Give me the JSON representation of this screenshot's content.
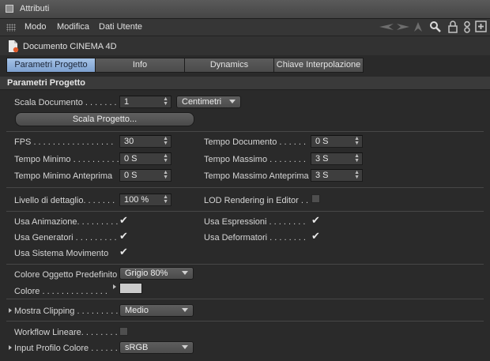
{
  "window": {
    "title": "Attributi"
  },
  "menu": {
    "items": [
      "Modo",
      "Modifica",
      "Dati Utente"
    ]
  },
  "toolbar_icons": [
    "back-arrow-icon",
    "forward-arrow-icon",
    "up-arrow-icon",
    "search-icon",
    "lock-icon",
    "link-icon",
    "new-panel-icon"
  ],
  "document": {
    "title": "Documento CINEMA 4D"
  },
  "tabs": [
    "Parametri Progetto",
    "Info",
    "Dynamics",
    "Chiave Interpolazione"
  ],
  "active_tab": "Parametri Progetto",
  "section": {
    "title": "Parametri Progetto"
  },
  "scala": {
    "label": "Scala Documento . . . . . . .",
    "value": "1",
    "unit": "Centimetri",
    "button": "Scala Progetto..."
  },
  "time": {
    "fps": {
      "label": "FPS . . . . . . . . . . . . . . . . .",
      "value": "30"
    },
    "tempo_minimo": {
      "label": "Tempo Minimo . . . . . . . . . .",
      "value": "0 S"
    },
    "tempo_minimo_anteprima": {
      "label": "Tempo Minimo Anteprima",
      "value": "0 S"
    },
    "tempo_documento": {
      "label": "Tempo Documento . . . . . .",
      "value": "0 S"
    },
    "tempo_massimo": {
      "label": "Tempo Massimo . . . . . . . .",
      "value": "3 S"
    },
    "tempo_massimo_anteprima": {
      "label": "Tempo Massimo Anteprima",
      "value": "3 S"
    }
  },
  "lod": {
    "label": "Livello di dettaglio. . . . . . .",
    "value": "100 %",
    "render_label": "LOD Rendering in Editor . .",
    "render_checked": false
  },
  "flags": {
    "usa_animazione": {
      "label": "Usa Animazione. . . . . . . . .",
      "checked": true
    },
    "usa_generatori": {
      "label": "Usa Generatori . . . . . . . . .",
      "checked": true
    },
    "usa_sistema_movimento": {
      "label": "Usa Sistema Movimento",
      "checked": true
    },
    "usa_espressioni": {
      "label": "Usa Espressioni . . . . . . . .",
      "checked": true
    },
    "usa_deformatori": {
      "label": "Usa Deformatori . . . . . . . .",
      "checked": true
    }
  },
  "colore": {
    "oggetto_label": "Colore Oggetto Predefinito",
    "oggetto_value": "Grigio 80%",
    "colore_label": "Colore . . . . . . . . . . . . . .",
    "swatch": "#cccccc"
  },
  "clipping": {
    "label": "Mostra Clipping . . . . . . . . .",
    "value": "Medio"
  },
  "workflow": {
    "label": "Workflow Lineare. . . . . . . .",
    "checked": false
  },
  "profilo": {
    "label": "Input Profilo Colore . . . . . . .",
    "value": "sRGB"
  },
  "colors": {
    "accent_tab": "#8fb0dc",
    "background": "#2a2a2a"
  }
}
